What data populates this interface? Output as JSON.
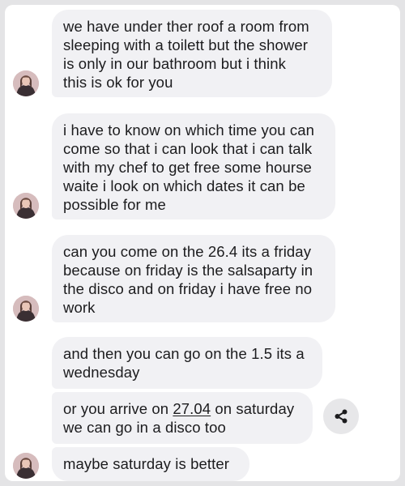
{
  "messages": [
    {
      "text": "we have under ther roof a room from\nsleeping with a toilett but the shower\nis only in our bathroom but i think\nthis is ok for you"
    },
    {
      "text": "i have to know on which time you can\ncome so that i can look that i can talk\nwith my chef to get free some hourse\nwaite i look on which dates it can be\npossible for me"
    },
    {
      "text": "can you come on the 26.4 its a friday\nbecause on friday is the salsaparty in\nthe disco and on friday i have free no\nwork"
    },
    {
      "text": "and then you can go on the 1.5 its a\nwednesday"
    },
    {
      "text_before": "or you arrive on ",
      "link": "27.04",
      "text_after": " on saturday\nwe can go in a disco too"
    },
    {
      "text": "maybe saturday is better"
    }
  ],
  "share": {
    "icon": "share-icon"
  },
  "avatar": {
    "icon": "profile-photo"
  }
}
